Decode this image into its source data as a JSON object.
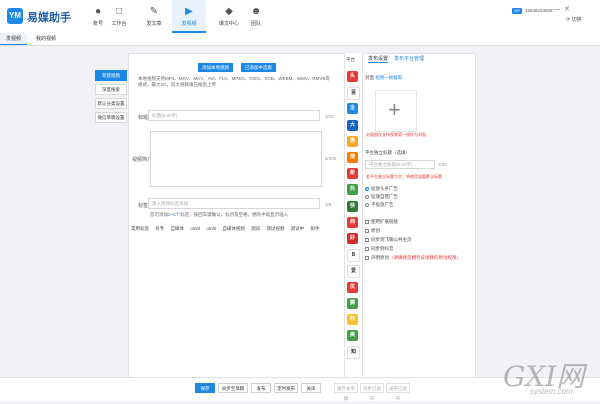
{
  "app": {
    "title": "易媒助手",
    "logo_text": "YM"
  },
  "nav": [
    {
      "label": "账号",
      "icon": "user-icon"
    },
    {
      "label": "工作台",
      "icon": "desk-icon"
    },
    {
      "label": "发文章",
      "icon": "article-icon"
    },
    {
      "label": "发视频",
      "icon": "video-icon",
      "active": true
    },
    {
      "label": "爆文中心",
      "icon": "fire-icon"
    },
    {
      "label": "团队",
      "icon": "team-icon"
    }
  ],
  "user": {
    "vip": "VIP",
    "phone": "15548423558",
    "switch_label": "切换"
  },
  "tabs": {
    "publish": "发视频",
    "mine": "我的视频"
  },
  "left_buttons": [
    "新建视频",
    "深度搜索",
    "默认分类设置",
    "微信草稿设置"
  ],
  "main": {
    "add_local": "添加本地视频",
    "add_online": "已添加中选取",
    "formats": "本地视频支持MP4、MOV、MKV、AVI、FLV、MPEG、OGG、VOB、WEBM、WMV、RMVB等格式，最大2G，较大视频请压缩后上传",
    "title_label": "标题",
    "title_placeholder": "标题(5-30字)",
    "title_count": "0/30",
    "intro_label": "视频简介",
    "intro_count": "0/300",
    "tag_label": "标签",
    "tag_placeholder": "输入视频标签添加",
    "tag_count": "0/5",
    "hint_prefix": "您可添加",
    "hint_blue": "2~5个",
    "hint_suffix": "标签，按回车键确认，标点及空格，拥有中就显示插入",
    "common_tags_label": "常用标签",
    "common_tags": [
      "有专",
      "自媒体",
      "omhl",
      "omhl",
      "自媒体视频",
      "测试",
      "测试视频",
      "测试中",
      "如手"
    ]
  },
  "platform_strip": {
    "header": "平台",
    "icons": [
      {
        "name": "toutiao-icon",
        "color": "#e53935",
        "glyph": "头"
      },
      {
        "name": "baijia-icon",
        "color": "#ffffff",
        "glyph": "百"
      },
      {
        "name": "qq-icon",
        "color": "#1e88e5",
        "glyph": "企"
      },
      {
        "name": "dayu-icon",
        "color": "#1565c0",
        "glyph": "大"
      },
      {
        "name": "weibo-icon",
        "color": "#f9a825",
        "glyph": "微"
      },
      {
        "name": "souhu-icon",
        "color": "#f57c00",
        "glyph": "搜"
      },
      {
        "name": "sina-icon",
        "color": "#e53935",
        "glyph": "新"
      },
      {
        "name": "douyin-icon",
        "color": "#43a047",
        "glyph": "抖"
      },
      {
        "name": "kuaishou-icon",
        "color": "#2e7d32",
        "glyph": "快"
      },
      {
        "name": "xigua-icon",
        "color": "#e53935",
        "glyph": "西"
      },
      {
        "name": "haokan-icon",
        "color": "#d32f2f",
        "glyph": "好"
      },
      {
        "name": "bilibili-icon",
        "color": "#ffffff",
        "glyph": "B"
      },
      {
        "name": "aiqiyi-icon",
        "color": "#ffffff",
        "glyph": "爱"
      },
      {
        "name": "youku-icon",
        "color": "#e53935",
        "glyph": "优"
      },
      {
        "name": "tengxun-icon",
        "color": "#43a047",
        "glyph": "腾"
      },
      {
        "name": "miaopai-icon",
        "color": "#fbc02d",
        "glyph": "秒"
      },
      {
        "name": "meipai-icon",
        "color": "#43a047",
        "glyph": "美"
      },
      {
        "name": "zhihu-icon",
        "color": "#ffffff",
        "glyph": "知"
      }
    ]
  },
  "right": {
    "tab_settings": "发布设置",
    "tab_manage": "发布平台管理",
    "cover_label": "封面",
    "cover_link": "视频一帧截取",
    "cover_warning": "封面图仅支持视频第一帧作为封面",
    "independent_title": "平台独立标题（选填）",
    "independent_placeholder": "平台独立标题(5-30字)",
    "independent_count": "0/30",
    "independent_warning": "若平台独立标题为空，将使用该篇默认标题",
    "ad_options": [
      "投放头条广告",
      "投放自营广告",
      "不投放广告"
    ],
    "extra_options": [
      {
        "label": "使用扩展链接"
      },
      {
        "label": "原创"
      },
      {
        "label": "同步到飞聊公共主页"
      },
      {
        "label": "同步到抖音"
      },
      {
        "label": "声明原创",
        "warn": "（请确保您拥有该视频的原创权限）"
      }
    ]
  },
  "bottom": {
    "buttons": [
      "保存",
      "同步至草稿",
      "发布",
      "定时发布",
      "关闭"
    ],
    "disabled_buttons": [
      "保存本草稿",
      "同步已发布",
      "发布已发布"
    ]
  },
  "watermark": {
    "logo": "GXI网",
    "url": "system.com"
  }
}
